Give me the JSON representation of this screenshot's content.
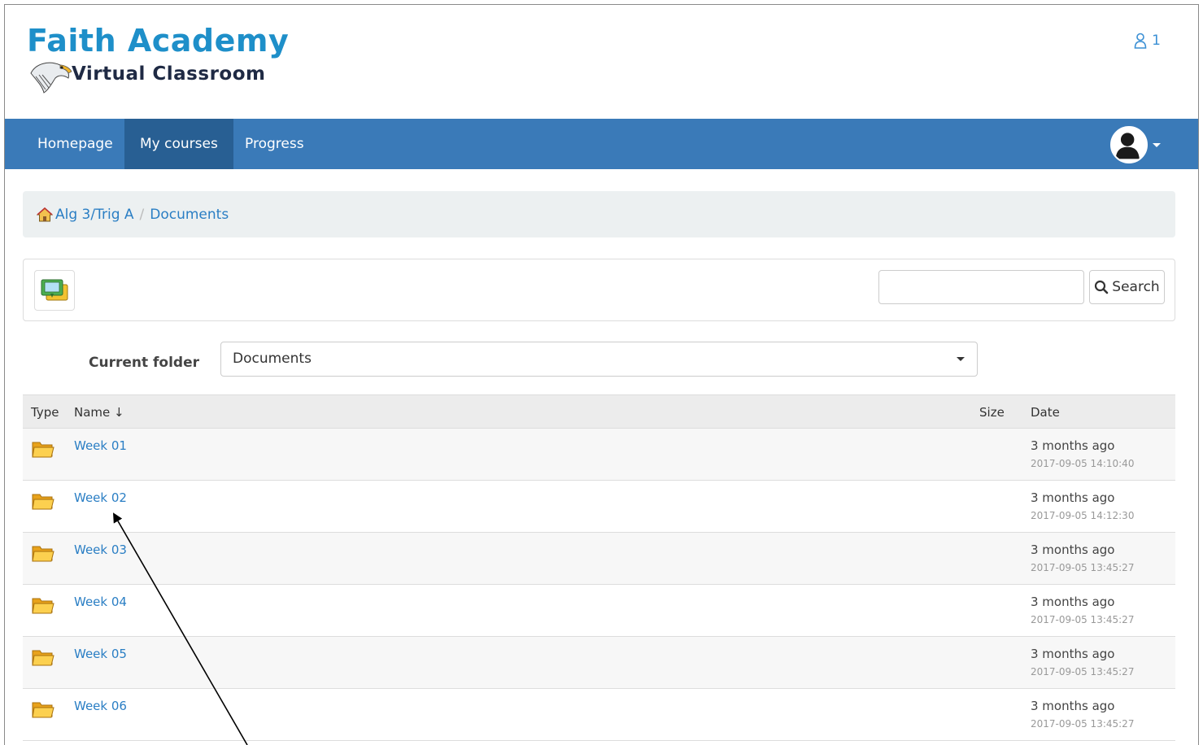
{
  "header": {
    "logo_title": "Faith Academy",
    "logo_subtitle": "Virtual Classroom",
    "online_users_count": "1"
  },
  "navbar": {
    "items": [
      {
        "label": "Homepage",
        "active": false
      },
      {
        "label": "My courses",
        "active": true
      },
      {
        "label": "Progress",
        "active": false
      }
    ]
  },
  "breadcrumb": {
    "course": "Alg 3/Trig A",
    "current": "Documents"
  },
  "toolbar": {
    "search_value": "",
    "search_label": "Search"
  },
  "folder": {
    "label": "Current folder",
    "selected": "Documents"
  },
  "table": {
    "headers": {
      "type": "Type",
      "name": "Name",
      "size": "Size",
      "date": "Date"
    },
    "rows": [
      {
        "name": "Week 01",
        "relative": "3 months ago",
        "timestamp": "2017-09-05 14:10:40"
      },
      {
        "name": "Week 02",
        "relative": "3 months ago",
        "timestamp": "2017-09-05 14:12:30"
      },
      {
        "name": "Week 03",
        "relative": "3 months ago",
        "timestamp": "2017-09-05 13:45:27"
      },
      {
        "name": "Week 04",
        "relative": "3 months ago",
        "timestamp": "2017-09-05 13:45:27"
      },
      {
        "name": "Week 05",
        "relative": "3 months ago",
        "timestamp": "2017-09-05 13:45:27"
      },
      {
        "name": "Week 06",
        "relative": "3 months ago",
        "timestamp": "2017-09-05 13:45:27"
      }
    ]
  },
  "colors": {
    "brand_blue": "#1e8fc9",
    "navbar": "#3a7ab8",
    "navbar_active": "#285f93",
    "link": "#2a7ec4"
  }
}
